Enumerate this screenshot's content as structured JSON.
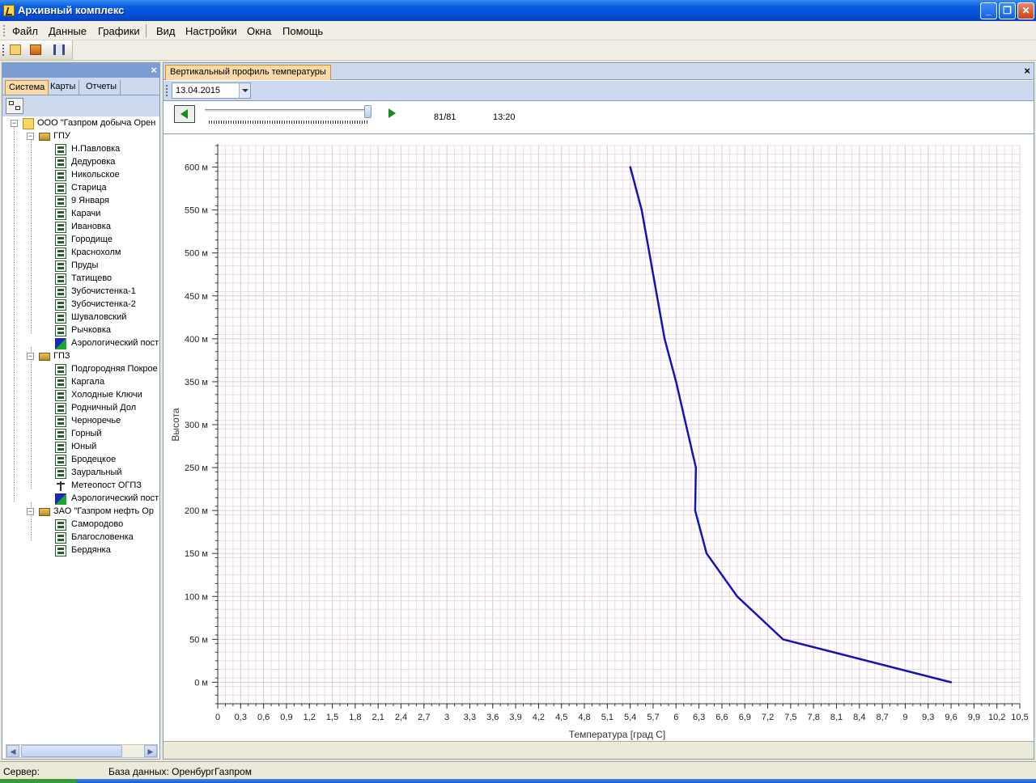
{
  "window": {
    "title": "Архивный комплекс",
    "buttons": {
      "minimize": "_",
      "restore": "❐",
      "close": "✕"
    }
  },
  "menu": {
    "items": [
      "Файл",
      "Данные",
      "Графики",
      "Вид",
      "Настройки",
      "Окна",
      "Помощь"
    ]
  },
  "left_panel": {
    "close": "×",
    "tabs": [
      "Система",
      "Карты",
      "Отчеты"
    ],
    "active_tab": "Система",
    "tree": [
      {
        "label": "ООО \"Газпром добыча Орен",
        "level": 0,
        "icon": "folder-icon",
        "expander": "−"
      },
      {
        "label": "ГПУ",
        "level": 1,
        "icon": "group-icon",
        "expander": "−"
      },
      {
        "label": "Н.Павловка",
        "level": 2,
        "icon": "station-icon"
      },
      {
        "label": "Дедуровка",
        "level": 2,
        "icon": "station-icon"
      },
      {
        "label": "Никольское",
        "level": 2,
        "icon": "station-icon"
      },
      {
        "label": "Старица",
        "level": 2,
        "icon": "station-icon"
      },
      {
        "label": "9 Января",
        "level": 2,
        "icon": "station-icon"
      },
      {
        "label": "Карачи",
        "level": 2,
        "icon": "station-icon"
      },
      {
        "label": "Ивановка",
        "level": 2,
        "icon": "station-icon"
      },
      {
        "label": "Городище",
        "level": 2,
        "icon": "station-icon"
      },
      {
        "label": "Краснохолм",
        "level": 2,
        "icon": "station-icon"
      },
      {
        "label": "Пруды",
        "level": 2,
        "icon": "station-icon"
      },
      {
        "label": "Татищево",
        "level": 2,
        "icon": "station-icon"
      },
      {
        "label": "Зубочистенка-1",
        "level": 2,
        "icon": "station-icon"
      },
      {
        "label": "Зубочистенка-2",
        "level": 2,
        "icon": "station-icon"
      },
      {
        "label": "Шуваловский",
        "level": 2,
        "icon": "station-icon"
      },
      {
        "label": "Рычковка",
        "level": 2,
        "icon": "station-icon"
      },
      {
        "label": "Аэрологический пост",
        "level": 2,
        "icon": "aerological-icon"
      },
      {
        "label": "ГПЗ",
        "level": 1,
        "icon": "group-icon",
        "expander": "−"
      },
      {
        "label": "Подгородняя Покрое",
        "level": 2,
        "icon": "station-icon"
      },
      {
        "label": "Каргала",
        "level": 2,
        "icon": "station-icon"
      },
      {
        "label": "Холодные Ключи",
        "level": 2,
        "icon": "station-icon"
      },
      {
        "label": "Родничный Дол",
        "level": 2,
        "icon": "station-icon"
      },
      {
        "label": "Черноречье",
        "level": 2,
        "icon": "station-icon"
      },
      {
        "label": "Горный",
        "level": 2,
        "icon": "station-icon"
      },
      {
        "label": "Юный",
        "level": 2,
        "icon": "station-icon"
      },
      {
        "label": "Бродецкое",
        "level": 2,
        "icon": "station-icon"
      },
      {
        "label": "Зауральный",
        "level": 2,
        "icon": "station-icon"
      },
      {
        "label": "Метеопост ОГПЗ",
        "level": 2,
        "icon": "meteo-icon"
      },
      {
        "label": "Аэрологический пост",
        "level": 2,
        "icon": "aerological-icon"
      },
      {
        "label": "ЗАО \"Газпром нефть Ор",
        "level": 1,
        "icon": "group-icon",
        "expander": "−"
      },
      {
        "label": "Самородово",
        "level": 2,
        "icon": "station-icon"
      },
      {
        "label": "Благословенка",
        "level": 2,
        "icon": "station-icon"
      },
      {
        "label": "Бердянка",
        "level": 2,
        "icon": "station-icon"
      }
    ]
  },
  "document": {
    "tab_label": "Вертикальный профиль температуры",
    "close": "×",
    "date": "13.04.2015",
    "frame_counter": "81/81",
    "time": "13:20",
    "slider_position": 1.0
  },
  "chart_data": {
    "type": "line",
    "xlabel": "Температура [град С]",
    "ylabel": "Высота",
    "xlim": [
      0,
      10.5
    ],
    "ylim": [
      -25,
      625
    ],
    "x_ticks": [
      "0",
      "0,3",
      "0,6",
      "0,9",
      "1,2",
      "1,5",
      "1,8",
      "2,1",
      "2,4",
      "2,7",
      "3",
      "3,3",
      "3,6",
      "3,9",
      "4,2",
      "4,5",
      "4,8",
      "5,1",
      "5,4",
      "5,7",
      "6",
      "6,3",
      "6,6",
      "6,9",
      "7,2",
      "7,5",
      "7,8",
      "8,1",
      "8,4",
      "8,7",
      "9",
      "9,3",
      "9,6",
      "9,9",
      "10,2",
      "10,5"
    ],
    "y_ticks": [
      "0 м",
      "50 м",
      "100 м",
      "150 м",
      "200 м",
      "250 м",
      "300 м",
      "350 м",
      "400 м",
      "450 м",
      "500 м",
      "550 м",
      "600 м"
    ],
    "grid": true,
    "series": [
      {
        "color": "#1414b4",
        "points": [
          [
            9.6,
            0
          ],
          [
            7.4,
            50
          ],
          [
            6.8,
            100
          ],
          [
            6.4,
            150
          ],
          [
            6.25,
            200
          ],
          [
            6.26,
            250
          ],
          [
            6.0,
            350
          ],
          [
            5.85,
            400
          ],
          [
            5.75,
            450
          ],
          [
            5.65,
            500
          ],
          [
            5.55,
            550
          ],
          [
            5.4,
            600
          ]
        ]
      }
    ]
  },
  "status_bar": {
    "server": "Сервер:",
    "database": "База данных: ОренбургГазпром"
  }
}
